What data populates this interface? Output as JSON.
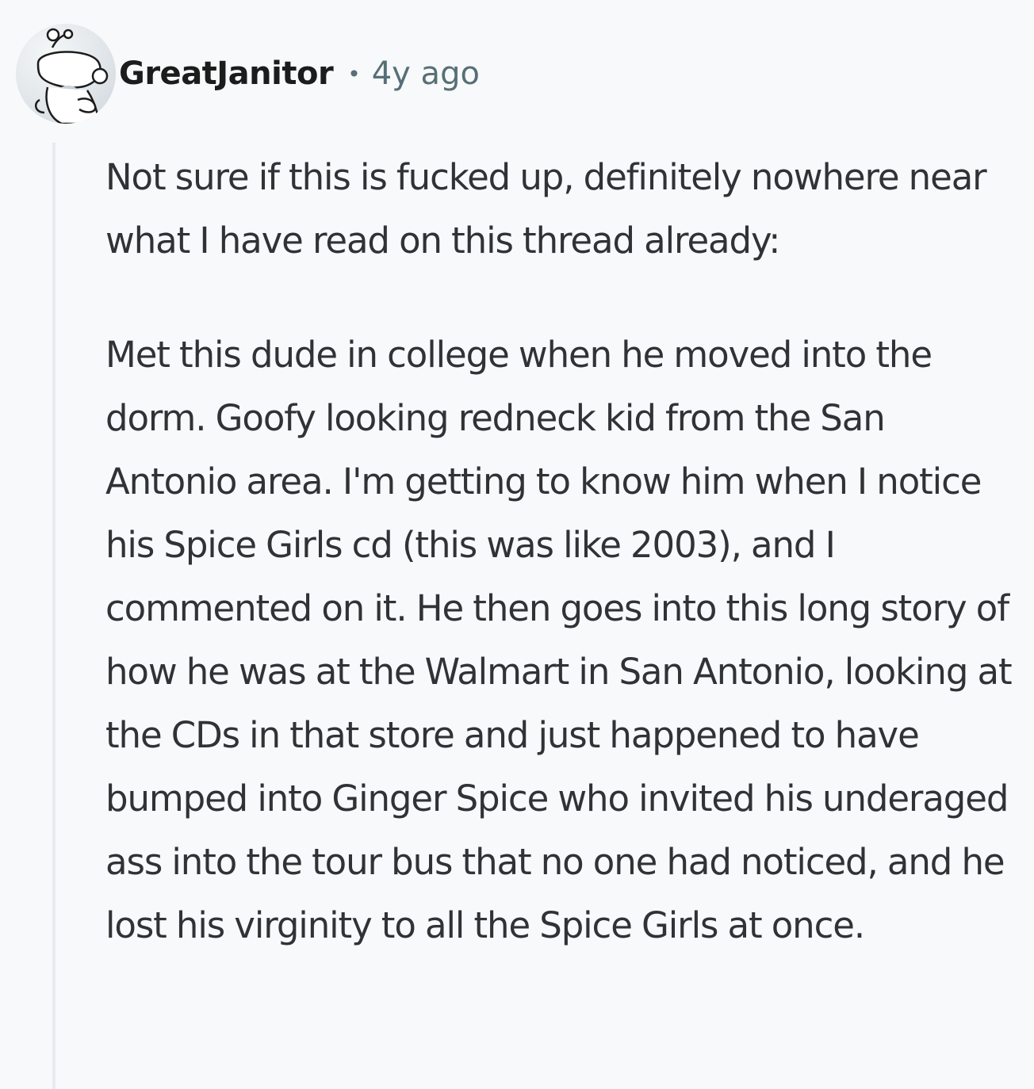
{
  "comment": {
    "author": "GreatJanitor",
    "separator": "•",
    "timestamp": "4y ago",
    "avatar_icon": "snoo-avatar-icon",
    "paragraphs": [
      "Not sure if this is fucked up, definitely nowhere near what I have read on this thread already:",
      "Met this dude in college when he moved into the dorm. Goofy looking redneck kid from the San Antonio area. I'm getting to know him when I notice his Spice Girls cd (this was like 2003), and I commented on it. He then goes into this long story of how he was at the Walmart in San Antonio, looking at the CDs in that store and just happened to have bumped into Ginger Spice who invited his underaged ass into the tour bus that no one had noticed, and he lost his virginity to all the Spice Girls at once."
    ]
  },
  "colors": {
    "background": "#f7f9fa",
    "text": "#2f3336",
    "meta": "#576f76",
    "thread_line": "#e5ebee"
  }
}
